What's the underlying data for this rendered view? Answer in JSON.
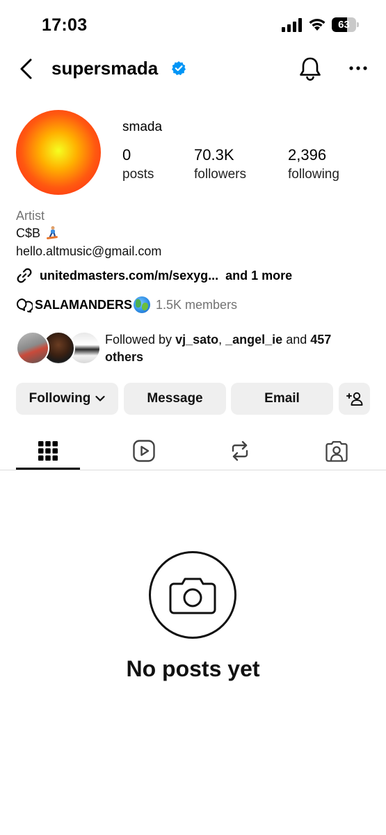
{
  "status_bar": {
    "time": "17:03",
    "battery": "63",
    "battery_level": 0.63
  },
  "header": {
    "username": "supersmada",
    "verified": true
  },
  "profile": {
    "display_name": "smada",
    "stats": [
      {
        "value": "0",
        "label": "posts"
      },
      {
        "value": "70.3K",
        "label": "followers"
      },
      {
        "value": "2,396",
        "label": "following"
      }
    ],
    "category": "Artist",
    "bio_line1": "C$B",
    "bio_emoji": "person-snowboarding",
    "bio_line2": "hello.altmusic@gmail.com",
    "link": "unitedmasters.com/m/sexyg...",
    "link_more": "and 1 more",
    "channel": {
      "name": "SALAMANDERS",
      "emoji": "globe",
      "members": "1.5K members"
    },
    "followed_by": {
      "prefix": "Followed by",
      "user1": "vj_sato",
      "sep": ",",
      "user2": "_angel_ie",
      "and": "and",
      "others": "457 others"
    }
  },
  "actions": {
    "following": "Following",
    "message": "Message",
    "email": "Email"
  },
  "tabs": [
    {
      "name": "posts-grid",
      "icon": "grid-icon",
      "active": true
    },
    {
      "name": "reels",
      "icon": "reels-icon",
      "active": false
    },
    {
      "name": "reposts",
      "icon": "repost-icon",
      "active": false
    },
    {
      "name": "tagged",
      "icon": "tagged-icon",
      "active": false
    }
  ],
  "empty_state": {
    "title": "No posts yet",
    "icon": "camera-icon"
  },
  "colors": {
    "verified": "#0095f6",
    "button_bg": "#efefef",
    "secondary_text": "#737373"
  }
}
